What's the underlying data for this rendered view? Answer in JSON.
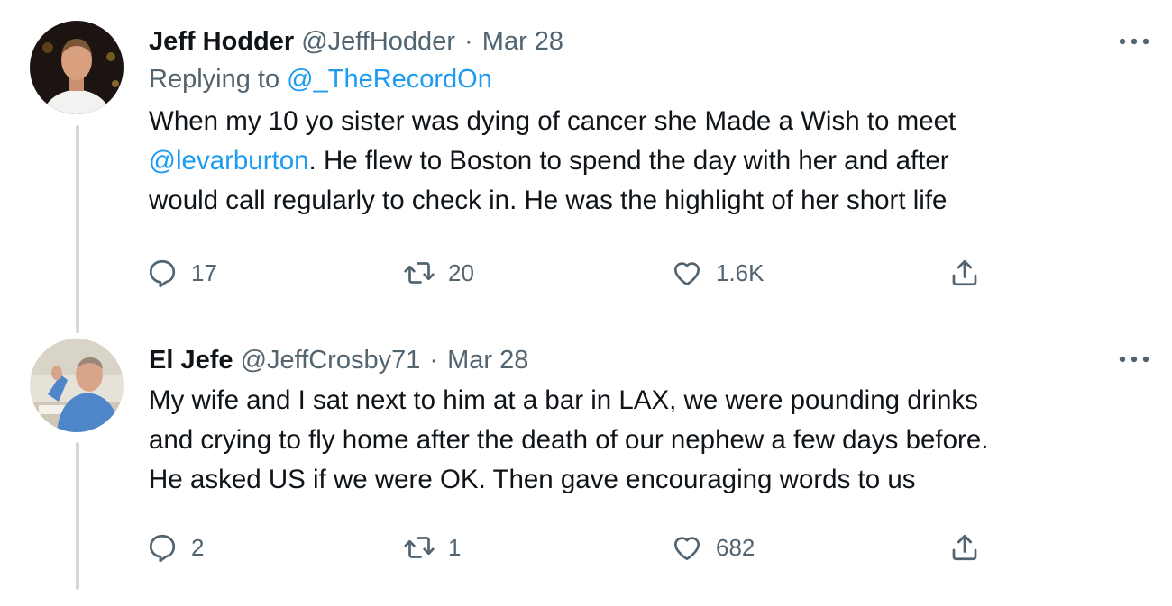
{
  "colors": {
    "text_primary": "#0f1419",
    "text_secondary": "#536471",
    "link": "#1d9bf0",
    "thread_line": "#cfd9de"
  },
  "tweets": [
    {
      "author": {
        "display_name": "Jeff Hodder",
        "handle": "@JeffHodder",
        "avatar": "avatar-photo"
      },
      "separator": "·",
      "date": "Mar 28",
      "replying_to": {
        "prefix": "Replying to ",
        "handle": "@_TheRecordOn"
      },
      "body": {
        "line1": "When my 10 yo sister was dying of cancer she Made a Wish to meet",
        "line2_mention": "@levarburton",
        "line2_rest": ". He flew to Boston to spend the day with her and after",
        "line3": "would call regularly to check in. He was the highlight of her short life"
      },
      "actions": {
        "reply_count": "17",
        "retweet_count": "20",
        "like_count": "1.6K",
        "icons": [
          "reply-icon",
          "retweet-icon",
          "like-icon",
          "share-icon"
        ]
      }
    },
    {
      "author": {
        "display_name": "El Jefe",
        "handle": "@JeffCrosby71",
        "avatar": "avatar-photo"
      },
      "separator": "·",
      "date": "Mar 28",
      "body": {
        "line1": "My wife and I sat next to him at a bar in LAX, we were pounding drinks",
        "line2": "and crying to fly home after the death of our nephew a few days before.",
        "line3": "He asked US if we were OK. Then gave encouraging words to us"
      },
      "actions": {
        "reply_count": "2",
        "retweet_count": "1",
        "like_count": "682",
        "icons": [
          "reply-icon",
          "retweet-icon",
          "like-icon",
          "share-icon"
        ]
      }
    }
  ]
}
